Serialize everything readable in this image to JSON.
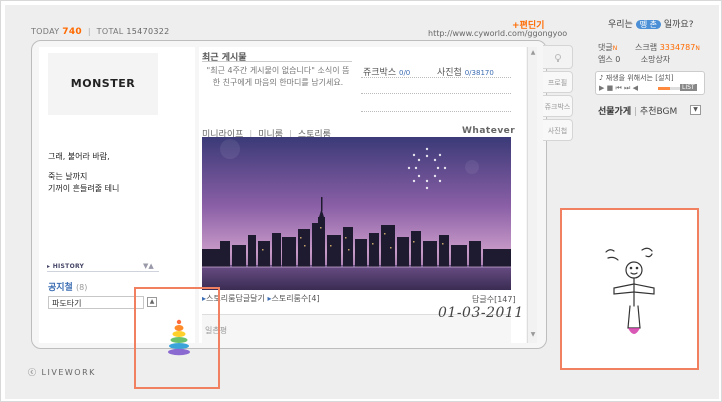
{
  "header": {
    "today_label": "TODAY",
    "today_value": "740",
    "separator": "|",
    "total_label": "TOTAL",
    "total_value": "15470322",
    "edit_link": "+편딘기",
    "url": "http://www.cyworld.com/ggongyoo"
  },
  "profile": {
    "logo_text": "MONSTER",
    "note_line1": "그래, 불어라 바람,",
    "note_line2": "죽는 날까지",
    "note_line3": "기꺼이 흔들려줄 테니",
    "history_label": "▸ HISTORY",
    "history_arrows": "▼▲",
    "notice_title": "공지철",
    "notice_count": "(8)",
    "notice_item": "파도타기",
    "notice_toggle": "▲"
  },
  "main": {
    "recent_title": "최근 게시물",
    "recent_text": "\"최근 4주간 게시물이 없습니다\" 소식이 뜸한 친구에게 마음의 한마디를 남기세요.",
    "jukebox_label": "쥬크박스",
    "jukebox_value": "0/0",
    "photo_label": "사진첩",
    "photo_value": "0/38170",
    "tab_minilife": "미니라이프",
    "tab_minirum": "미니룸",
    "tab_storyroom": "스토리룸",
    "tab_sep": "|",
    "whatever": "Whatever",
    "story_reply": "스토리룸답글달기",
    "story_count": "스토리룸수[4]",
    "reply_count": "답글수[147]",
    "date_stamp": "01-03-2011",
    "comment_label": "일촌평"
  },
  "side_tabs": [
    "프로필",
    "쥬크박스",
    "사진첩"
  ],
  "right": {
    "friend_q_prefix": "우리는",
    "friend_q_pill": "뗑 촌",
    "friend_q_suffix": "일까요?",
    "comments_label": "댓글",
    "scrap_label": "스크랩",
    "scrap_value": "3334787",
    "apps_label": "앱스",
    "apps_value": "0",
    "shop_label": "소망상자",
    "player_title": "♪ 재생을 위해서는 [설치]",
    "list_btn": "LIST",
    "gift_label": "선물가게",
    "bgm_label": "추천BGM",
    "gift_select": "▼"
  },
  "footer": {
    "livework": "ⓒ LIVEWORK"
  },
  "colors": {
    "accent_orange": "#ff6a00",
    "link_blue": "#3b6cb2",
    "callout_border": "#f08060"
  },
  "icons": [
    "sun-rays-icon",
    "rainbow-stack-icon",
    "stick-figure-drawing"
  ]
}
